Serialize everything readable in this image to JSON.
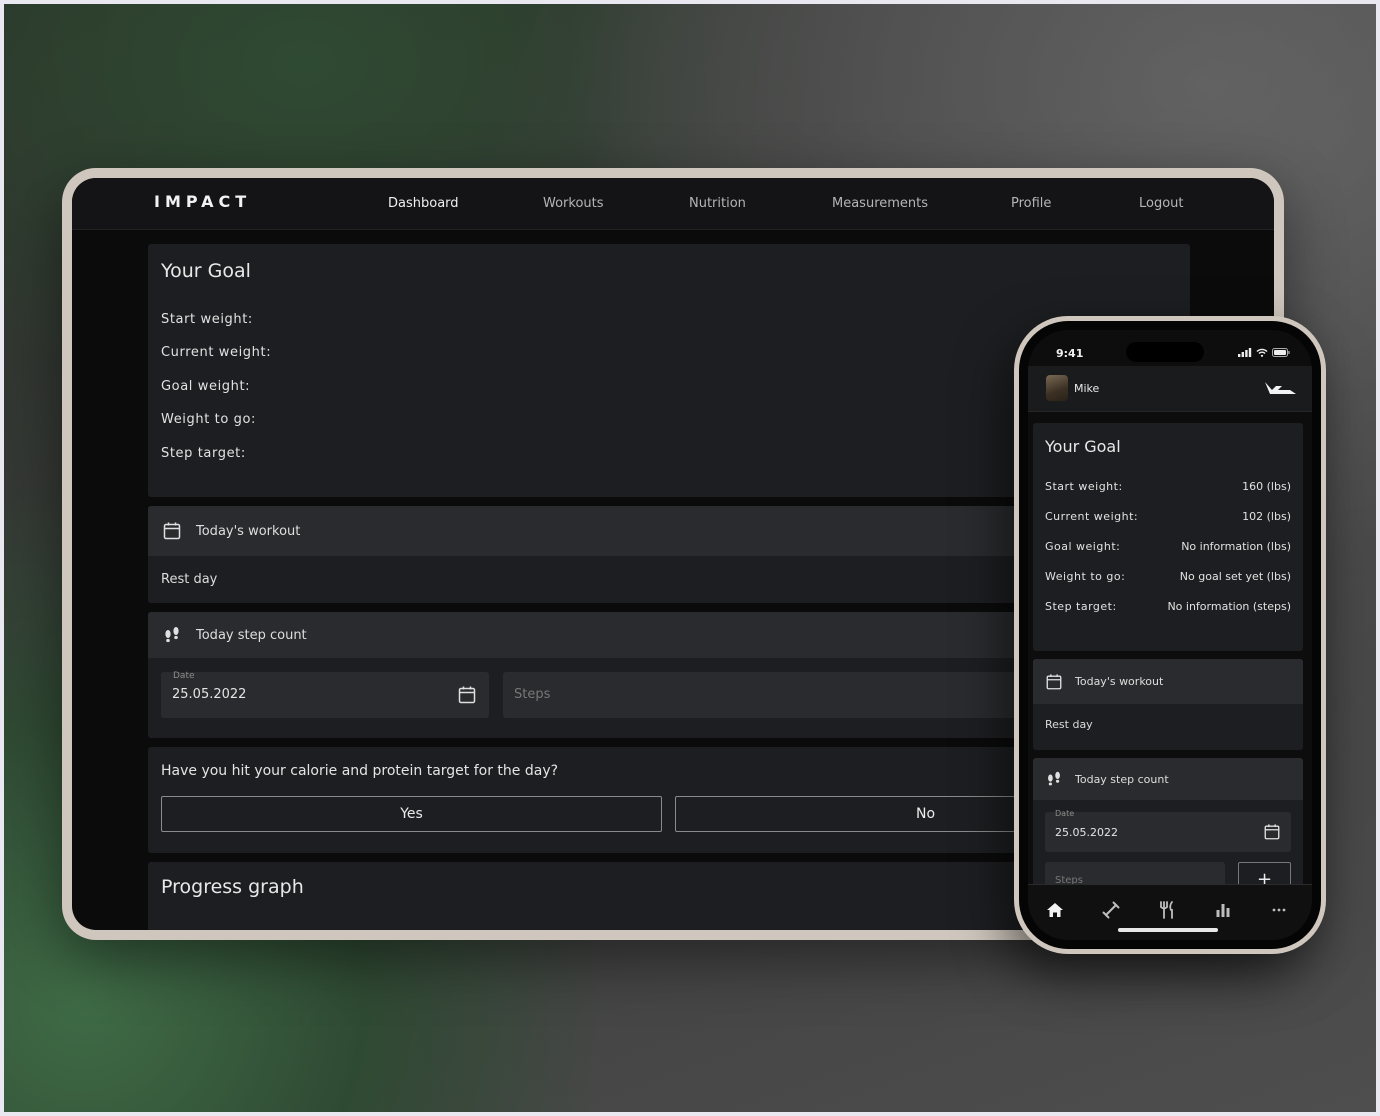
{
  "tablet": {
    "logo": "IMPACT",
    "nav": [
      "Dashboard",
      "Workouts",
      "Nutrition",
      "Measurements",
      "Profile",
      "Logout"
    ],
    "goal": {
      "title": "Your Goal",
      "rows": [
        "Start weight:",
        "Current weight:",
        "Goal weight:",
        "Weight to go:",
        "Step target:"
      ]
    },
    "workout": {
      "title": "Today's workout",
      "body": "Rest day"
    },
    "steps": {
      "title": "Today step count",
      "date_caption": "Date",
      "date_value": "25.05.2022",
      "steps_placeholder": "Steps"
    },
    "calorie": {
      "question": "Have you hit your calorie and protein target for the day?",
      "yes": "Yes",
      "no": "No"
    },
    "progress": {
      "title": "Progress graph"
    }
  },
  "phone": {
    "time": "9:41",
    "user": "Mike",
    "goal": {
      "title": "Your Goal",
      "rows": [
        {
          "label": "Start weight:",
          "value": "160 (lbs)"
        },
        {
          "label": "Current weight:",
          "value": "102 (lbs)"
        },
        {
          "label": "Goal weight:",
          "value": "No information (lbs)"
        },
        {
          "label": "Weight to go:",
          "value": "No goal set yet (lbs)"
        },
        {
          "label": "Step target:",
          "value": "No information (steps)"
        }
      ]
    },
    "workout": {
      "title": "Today's workout",
      "body": "Rest day"
    },
    "steps": {
      "title": "Today step count",
      "date_caption": "Date",
      "date_value": "25.05.2022",
      "steps_placeholder": "Steps",
      "add": "+"
    },
    "tabs": [
      "home-icon",
      "dumbbell-icon",
      "fork-knife-icon",
      "bar-chart-icon",
      "more-icon"
    ]
  },
  "colors": {
    "card": "#1d1e21",
    "card_header": "#2a2b2e",
    "frame": "#cfc7bd"
  }
}
